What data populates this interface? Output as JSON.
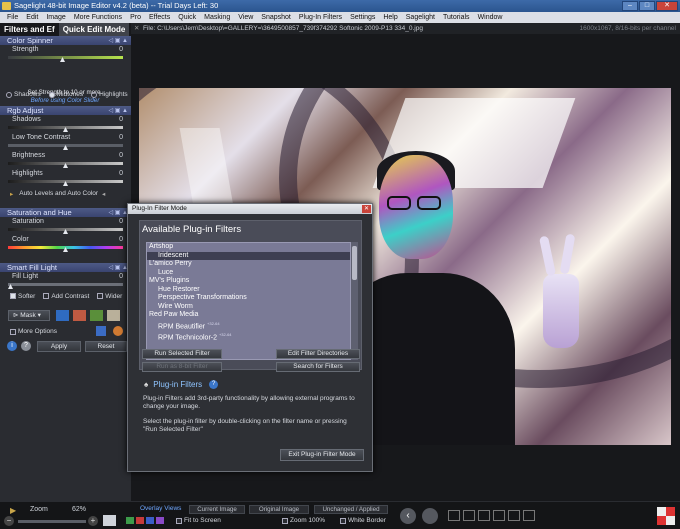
{
  "window": {
    "title": "Sagelight 48-bit Image Editor v4.2 (beta) -- Trial Days Left: 30"
  },
  "menu": [
    "File",
    "Edit",
    "Image",
    "More Functions",
    "Pro",
    "Effects",
    "Quick",
    "Masking",
    "View",
    "Snapshot",
    "Plug-In Filters",
    "Settings",
    "Help",
    "Sagelight",
    "Tutorials",
    "Window"
  ],
  "left_panel": {
    "tabs": [
      "Filters and Ef",
      "Quick Edit Mode"
    ],
    "color_spinner": {
      "title": "Color Spinner",
      "strength_label": "Strength",
      "strength_value": "0",
      "hint_line1": "Set Strength to 10 or more.",
      "hint_line2": "Before using Color Slider"
    },
    "tone_radio": [
      "Shadows",
      "Midtones",
      "Highlights"
    ],
    "rgb_adjust": {
      "title": "Rgb Adjust",
      "sliders": [
        {
          "label": "Shadows",
          "value": "0"
        },
        {
          "label": "Low Tone Contrast",
          "value": "0"
        },
        {
          "label": "Brightness",
          "value": "0"
        },
        {
          "label": "Highlights",
          "value": "0"
        }
      ],
      "auto_label": "Auto Levels and Auto Color"
    },
    "saturation": {
      "title": "Saturation and Hue",
      "sliders": [
        {
          "label": "Saturation",
          "value": "0"
        },
        {
          "label": "Color",
          "value": "0"
        }
      ]
    },
    "smart_fill": {
      "title": "Smart Fill Light",
      "fill_label": "Fill Light",
      "fill_value": "0",
      "checks": [
        "Softer",
        "Add Contrast",
        "Wider"
      ]
    },
    "mask_label": "Mask",
    "more_options": "More Options",
    "apply": "Apply",
    "reset": "Reset"
  },
  "canvas": {
    "file": "File: C:\\Users\\Jem\\Desktop\\=GALLERY=\\3649500857_739f374292 Softonic 2009-P13 334_0.jpg",
    "resolution": "1600x1067, 8/16-bits per channel"
  },
  "dialog": {
    "title": "Plug-In Filter Mode",
    "heading": "Available Plug-in Filters",
    "list": [
      {
        "text": "Artshop",
        "kind": "cat"
      },
      {
        "text": "Iridescent",
        "kind": "sub",
        "selected": true
      },
      {
        "text": "L'amico Perry",
        "kind": "cat"
      },
      {
        "text": "Luce",
        "kind": "sub"
      },
      {
        "text": "MV's Plugins",
        "kind": "cat"
      },
      {
        "text": "Hue Restorer",
        "kind": "sub"
      },
      {
        "text": "Perspective Transformations",
        "kind": "sub"
      },
      {
        "text": "Wire Worm",
        "kind": "sub"
      },
      {
        "text": "Red Paw Media",
        "kind": "cat"
      },
      {
        "text": "RPM Beautifier",
        "kind": "sub",
        "sup": "+32-64"
      },
      {
        "text": "RPM Technicolor-2",
        "kind": "sub",
        "sup": "+32-64"
      }
    ],
    "btn_run": "Run Selected Filter",
    "btn_edit_dirs": "Edit Filter Directories",
    "btn_run_last": "Run as 8-bit Filter",
    "btn_search": "Search for Filters",
    "pf_title": "Plug-in Filters",
    "desc1": "Plug-in Filters add 3rd-party functionality by allowing external programs to change your image.",
    "desc2": "Select the plug-in filter by double-clicking on the filter name or pressing \"Run Selected Filter\"",
    "btn_exit": "Exit Plug-in Filter Mode"
  },
  "status": {
    "zoom_label": "Zoom",
    "zoom_value": "62%",
    "overlay_views": "Overlay Views",
    "current_image": "Current Image",
    "original_image": "Original Image",
    "unchanged_applied": "Unchanged / Applied",
    "fit_to_screen": "Fit to Screen",
    "zoom_100": "Zoom 100%",
    "white_border": "White Border"
  }
}
